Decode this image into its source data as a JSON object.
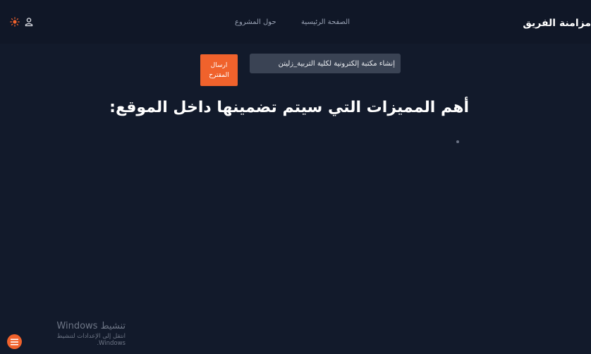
{
  "header": {
    "brand": "مزامنة الفريق",
    "nav": [
      {
        "label": "الصفحة الرئيسية"
      },
      {
        "label": "حول المشروع"
      }
    ],
    "icons": {
      "theme": "sun-icon",
      "account": "user-icon"
    }
  },
  "suggestion": {
    "input_value": "إنشاء مكتبة إلكترونية لكلية التربية_زليتن",
    "button_label": "ارسال المقترح"
  },
  "main": {
    "heading": "أهم المميزات التي سيتم تضمينها داخل الموقع:"
  },
  "activation": {
    "title": "تنشيط Windows",
    "subtitle": "انتقل إلى الإعدادات لتنشيط Windows."
  },
  "colors": {
    "background": "#121a2b",
    "accent": "#f0622c",
    "input_bg": "#3a4354"
  }
}
